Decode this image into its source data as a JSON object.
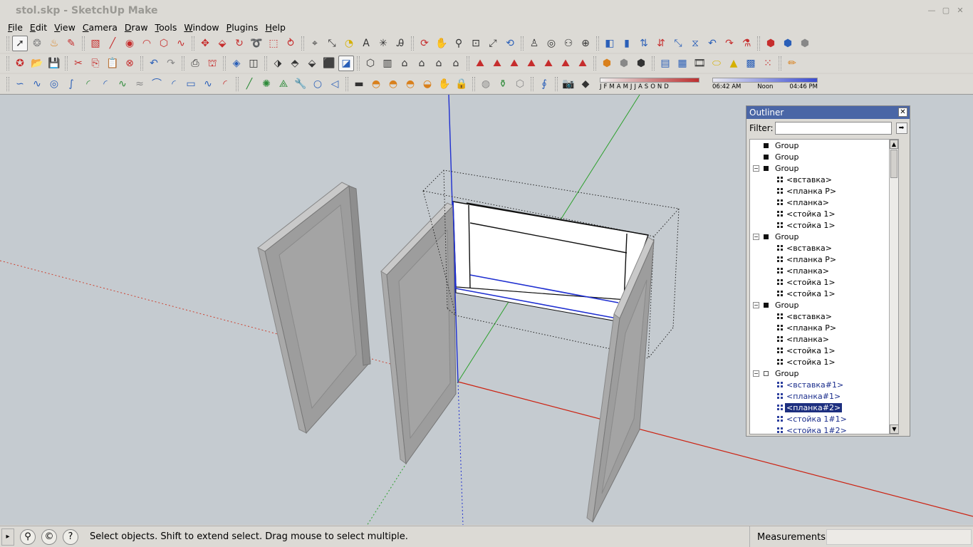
{
  "window": {
    "title": "stol.skp - SketchUp Make"
  },
  "menu": [
    "File",
    "Edit",
    "View",
    "Camera",
    "Draw",
    "Tools",
    "Window",
    "Plugins",
    "Help"
  ],
  "shadow": {
    "months": [
      "J",
      "F",
      "M",
      "A",
      "M",
      "J",
      "J",
      "A",
      "S",
      "O",
      "N",
      "D"
    ],
    "time_start": "06:42 AM",
    "time_mid": "Noon",
    "time_end": "04:46 PM"
  },
  "outliner": {
    "title": "Outliner",
    "filter_label": "Filter:",
    "filter_value": "",
    "rows": [
      {
        "label": "Group",
        "kind": "group",
        "level": 0,
        "toggle": ""
      },
      {
        "label": "Group",
        "kind": "group",
        "level": 0,
        "toggle": ""
      },
      {
        "label": "Group",
        "kind": "group",
        "level": 0,
        "toggle": "−"
      },
      {
        "label": "<вставка>",
        "kind": "comp",
        "level": 1
      },
      {
        "label": "<планка P>",
        "kind": "comp",
        "level": 1
      },
      {
        "label": "<планка>",
        "kind": "comp",
        "level": 1
      },
      {
        "label": "<стойка 1>",
        "kind": "comp",
        "level": 1
      },
      {
        "label": "<стойка 1>",
        "kind": "comp",
        "level": 1
      },
      {
        "label": "Group",
        "kind": "group",
        "level": 0,
        "toggle": "−"
      },
      {
        "label": "<вставка>",
        "kind": "comp",
        "level": 1
      },
      {
        "label": "<планка P>",
        "kind": "comp",
        "level": 1
      },
      {
        "label": "<планка>",
        "kind": "comp",
        "level": 1
      },
      {
        "label": "<стойка 1>",
        "kind": "comp",
        "level": 1
      },
      {
        "label": "<стойка 1>",
        "kind": "comp",
        "level": 1
      },
      {
        "label": "Group",
        "kind": "group",
        "level": 0,
        "toggle": "−"
      },
      {
        "label": "<вставка>",
        "kind": "comp",
        "level": 1
      },
      {
        "label": "<планка P>",
        "kind": "comp",
        "level": 1
      },
      {
        "label": "<планка>",
        "kind": "comp",
        "level": 1
      },
      {
        "label": "<стойка 1>",
        "kind": "comp",
        "level": 1
      },
      {
        "label": "<стойка 1>",
        "kind": "comp",
        "level": 1
      },
      {
        "label": "Group",
        "kind": "group-open",
        "level": 0,
        "toggle": "−"
      },
      {
        "label": "<вставка#1>",
        "kind": "comp-blue",
        "level": 1
      },
      {
        "label": "<планка#1>",
        "kind": "comp-blue",
        "level": 1
      },
      {
        "label": "<планка#2>",
        "kind": "comp-selected",
        "level": 1
      },
      {
        "label": "<стойка 1#1>",
        "kind": "comp-blue",
        "level": 1
      },
      {
        "label": "<стойка 1#2>",
        "kind": "comp-blue",
        "level": 1
      }
    ]
  },
  "status": {
    "message": "Select objects. Shift to extend select. Drag mouse to select multiple.",
    "measurements_label": "Measurements",
    "measurements_value": ""
  }
}
